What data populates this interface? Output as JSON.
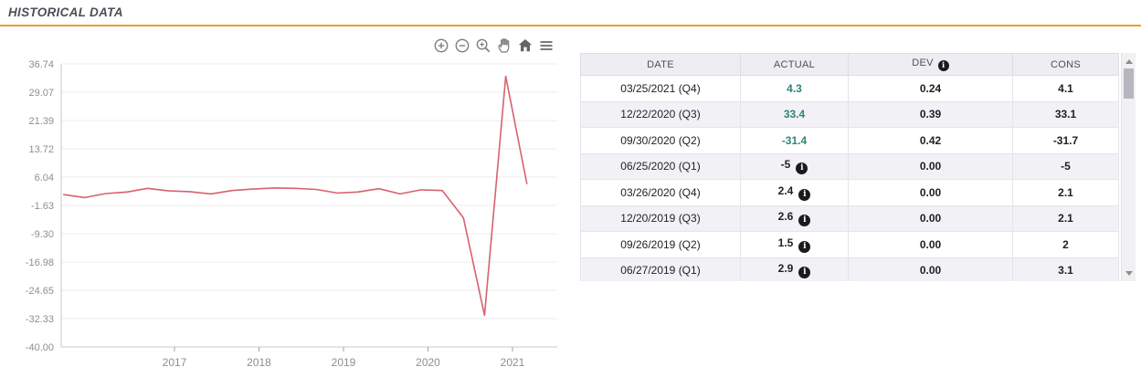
{
  "section": {
    "title": "HISTORICAL DATA"
  },
  "colors": {
    "accent": "#f09c2f",
    "line": "#d6626c",
    "positive_green": "#2e8676",
    "header_bg": "#ededf2",
    "row_stripe": "#f1f1f6"
  },
  "toolbar": {
    "icons": [
      "zoom-in-icon",
      "zoom-out-icon",
      "box-zoom-icon",
      "pan-icon",
      "home-icon",
      "menu-icon"
    ]
  },
  "chart_data": {
    "type": "line",
    "title": "",
    "xlabel": "",
    "ylabel": "",
    "grid": true,
    "legend": false,
    "xlim": [
      2015.66,
      2021.53
    ],
    "ylim": [
      -40,
      36.74
    ],
    "x_ticks": [
      2017,
      2018,
      2019,
      2020,
      2021
    ],
    "y_ticks": [
      36.74,
      29.07,
      21.39,
      13.72,
      6.04,
      -1.63,
      -9.3,
      -16.98,
      -24.65,
      -32.33,
      -40
    ],
    "series": [
      {
        "name": "Actual",
        "color": "#d6626c",
        "x": [
          2015.69,
          2015.94,
          2016.19,
          2016.44,
          2016.68,
          2016.93,
          2017.18,
          2017.43,
          2017.68,
          2017.93,
          2018.18,
          2018.43,
          2018.68,
          2018.93,
          2019.17,
          2019.42,
          2019.67,
          2019.92,
          2020.17,
          2020.42,
          2020.67,
          2020.92,
          2021.17
        ],
        "y": [
          1.3,
          0.5,
          1.6,
          2.0,
          3.0,
          2.3,
          2.1,
          1.5,
          2.4,
          2.8,
          3.1,
          3.0,
          2.7,
          1.7,
          2.0,
          2.9,
          1.5,
          2.6,
          2.4,
          -5,
          -31.4,
          33.4,
          4.3
        ]
      }
    ]
  },
  "table": {
    "columns": [
      "DATE",
      "ACTUAL",
      "DEV",
      "CONS"
    ],
    "rows": [
      {
        "date": "03/25/2021 (Q4)",
        "actual": "4.3",
        "actual_color": "green",
        "actual_info": false,
        "dev": "0.24",
        "cons": "4.1"
      },
      {
        "date": "12/22/2020 (Q3)",
        "actual": "33.4",
        "actual_color": "green",
        "actual_info": false,
        "dev": "0.39",
        "cons": "33.1"
      },
      {
        "date": "09/30/2020 (Q2)",
        "actual": "-31.4",
        "actual_color": "green",
        "actual_info": false,
        "dev": "0.42",
        "cons": "-31.7"
      },
      {
        "date": "06/25/2020 (Q1)",
        "actual": "-5",
        "actual_color": "black",
        "actual_info": true,
        "dev": "0.00",
        "cons": "-5"
      },
      {
        "date": "03/26/2020 (Q4)",
        "actual": "2.4",
        "actual_color": "black",
        "actual_info": true,
        "dev": "0.00",
        "cons": "2.1"
      },
      {
        "date": "12/20/2019 (Q3)",
        "actual": "2.6",
        "actual_color": "black",
        "actual_info": true,
        "dev": "0.00",
        "cons": "2.1"
      },
      {
        "date": "09/26/2019 (Q2)",
        "actual": "1.5",
        "actual_color": "black",
        "actual_info": true,
        "dev": "0.00",
        "cons": "2"
      },
      {
        "date": "06/27/2019 (Q1)",
        "actual": "2.9",
        "actual_color": "black",
        "actual_info": true,
        "dev": "0.00",
        "cons": "3.1"
      }
    ]
  }
}
